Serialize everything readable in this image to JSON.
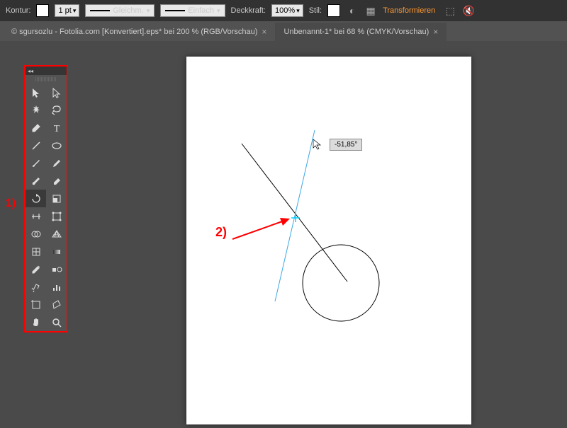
{
  "top_bar": {
    "kontur_label": "Kontur:",
    "stroke_weight": "1 pt",
    "stroke_type1": "Gleichm.",
    "stroke_type2": "Einfach",
    "deckkraft_label": "Deckkraft:",
    "deckkraft_value": "100%",
    "stil_label": "Stil:",
    "transform_label": "Transformieren"
  },
  "tabs": {
    "tab1": "© sgursozlu - Fotolia.com [Konvertiert].eps* bei 200 % (RGB/Vorschau)",
    "tab2": "Unbenannt-1* bei 68 % (CMYK/Vorschau)"
  },
  "annotations": {
    "label1": "1)",
    "label2": "2)"
  },
  "angle_tooltip": "-51,85°",
  "tool_names": [
    "selection-tool",
    "direct-selection-tool",
    "magic-wand-tool",
    "lasso-tool",
    "pen-tool",
    "type-tool",
    "line-tool",
    "shape-tool",
    "paintbrush-tool",
    "pencil-tool",
    "blob-brush-tool",
    "eraser-tool",
    "rotate-tool",
    "scale-tool",
    "width-tool",
    "free-transform-tool",
    "shape-builder-tool",
    "perspective-grid-tool",
    "mesh-tool",
    "gradient-tool",
    "eyedropper-tool",
    "blend-tool",
    "symbol-sprayer-tool",
    "column-graph-tool",
    "artboard-tool",
    "slice-tool",
    "hand-tool",
    "zoom-tool"
  ]
}
